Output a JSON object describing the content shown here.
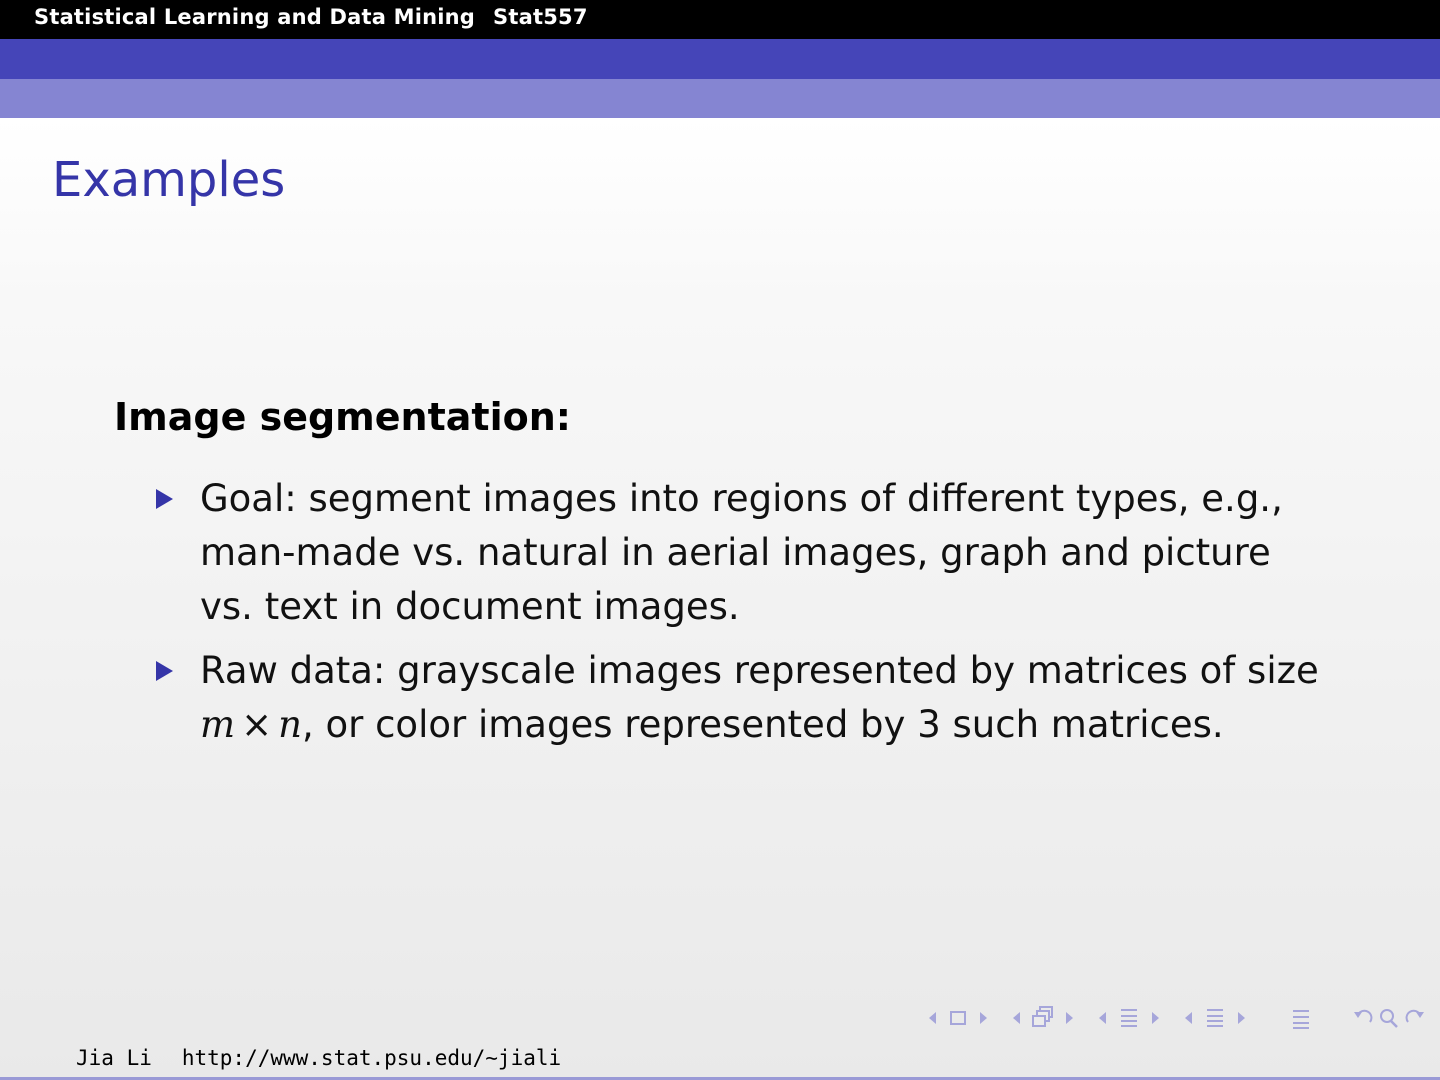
{
  "header": {
    "course": "Statistical Learning and Data Mining",
    "code": "Stat557"
  },
  "frame": {
    "title": "Examples"
  },
  "section": {
    "heading": "Image segmentation:"
  },
  "bullets": {
    "goal": "Goal: segment images into regions of different types, e.g., man-made vs. natural in aerial images, graph and picture vs. text in document images.",
    "raw_prefix": "Raw data: grayscale images represented by matrices of size",
    "raw_m": "m",
    "raw_times": "×",
    "raw_n": "n",
    "raw_suffix": ", or color images represented by 3 such matrices."
  },
  "footer": {
    "author": "Jia Li",
    "url": "http://www.stat.psu.edu/∼jiali"
  },
  "colors": {
    "title_blue": "#3535a8",
    "band_dark": "#4545b8",
    "band_light": "#8585d2",
    "nav_icons": "#a6a6da"
  },
  "nav_icons": [
    "arrow-left-icon",
    "frame-icon",
    "arrow-right-icon",
    "arrow-left-icon",
    "subsection-icon",
    "arrow-right-icon",
    "arrow-left-icon",
    "section-icon",
    "arrow-right-icon",
    "align-icon",
    "undo-icon",
    "search-icon",
    "redo-icon"
  ]
}
